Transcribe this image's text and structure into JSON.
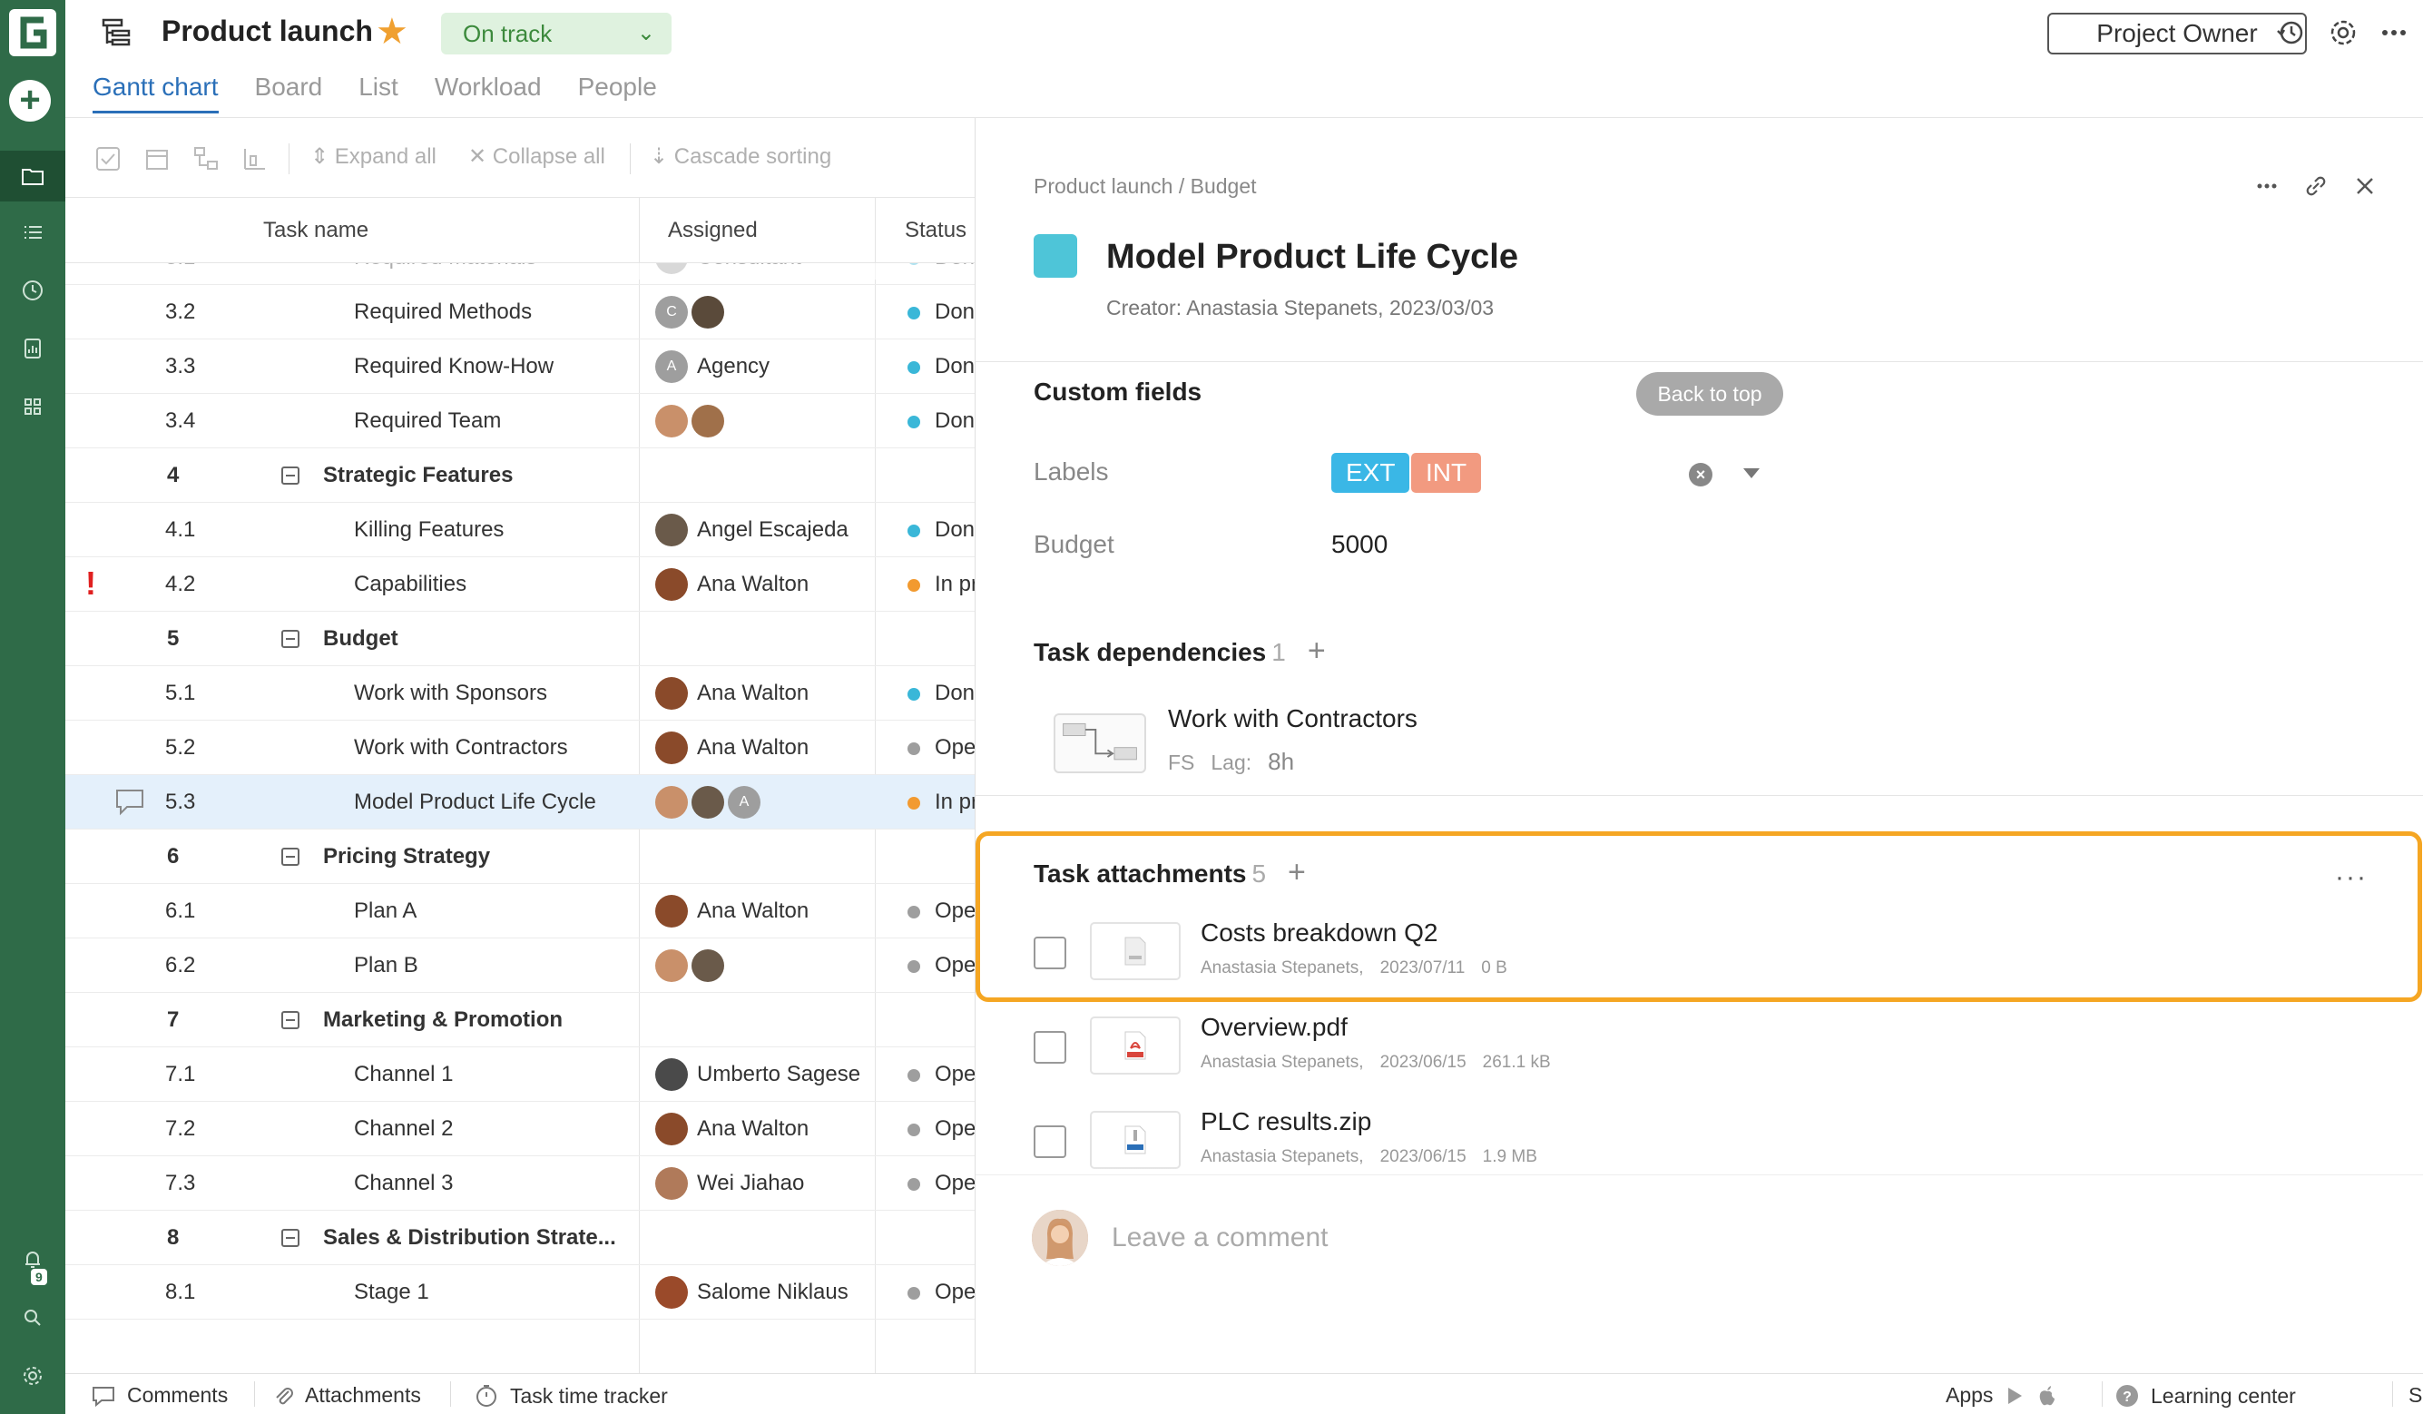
{
  "app": {
    "project_title": "Product launch",
    "status": "On track",
    "project_owner": "Project Owner",
    "notification_count": "9"
  },
  "tabs": [
    {
      "label": "Gantt chart",
      "active": true
    },
    {
      "label": "Board"
    },
    {
      "label": "List"
    },
    {
      "label": "Workload"
    },
    {
      "label": "People"
    }
  ],
  "toolbar": {
    "expand_all": "Expand all",
    "collapse_all": "Collapse all",
    "cascade_sorting": "Cascade sorting"
  },
  "table": {
    "headers": {
      "task_name": "Task name",
      "assigned": "Assigned",
      "status": "Status"
    },
    "rows": [
      {
        "num": "3.1",
        "name": "Required Materials",
        "assignee": "Consultant",
        "status": "Done",
        "status_color": "#3ab7d8",
        "avatars": [
          "C"
        ]
      },
      {
        "num": "3.2",
        "name": "Required Methods",
        "assignee": "",
        "status": "Done",
        "status_color": "#3ab7d8",
        "avatars": [
          "C",
          "p1"
        ]
      },
      {
        "num": "3.3",
        "name": "Required Know-How",
        "assignee": "Agency",
        "status": "Done",
        "status_color": "#3ab7d8",
        "avatars": [
          "A"
        ]
      },
      {
        "num": "3.4",
        "name": "Required Team",
        "assignee": "",
        "status": "Done",
        "status_color": "#3ab7d8",
        "avatars": [
          "p2",
          "p3"
        ]
      },
      {
        "num": "4",
        "name": "Strategic Features",
        "group": true
      },
      {
        "num": "4.1",
        "name": "Killing Features",
        "assignee": "Angel Escajeda",
        "status": "Done",
        "status_color": "#3ab7d8",
        "avatars": [
          "p4"
        ]
      },
      {
        "num": "4.2",
        "name": "Capabilities",
        "assignee": "Ana Walton",
        "status": "In progress",
        "status_color": "#f29a30",
        "avatars": [
          "p5"
        ],
        "warning": true
      },
      {
        "num": "5",
        "name": "Budget",
        "group": true
      },
      {
        "num": "5.1",
        "name": "Work with Sponsors",
        "assignee": "Ana Walton",
        "status": "Done",
        "status_color": "#3ab7d8",
        "avatars": [
          "p5"
        ]
      },
      {
        "num": "5.2",
        "name": "Work with Contractors",
        "assignee": "Ana Walton",
        "status": "Open",
        "status_color": "#9e9e9e",
        "avatars": [
          "p5"
        ]
      },
      {
        "num": "5.3",
        "name": "Model Product Life Cycle",
        "assignee": "",
        "status": "In progress",
        "status_color": "#f29a30",
        "avatars": [
          "p2",
          "p4",
          "A"
        ],
        "selected": true,
        "comment": true
      },
      {
        "num": "6",
        "name": "Pricing Strategy",
        "group": true
      },
      {
        "num": "6.1",
        "name": "Plan A",
        "assignee": "Ana Walton",
        "status": "Open",
        "status_color": "#9e9e9e",
        "avatars": [
          "p5"
        ]
      },
      {
        "num": "6.2",
        "name": "Plan B",
        "assignee": "",
        "status": "Open",
        "status_color": "#9e9e9e",
        "avatars": [
          "p2",
          "p4"
        ]
      },
      {
        "num": "7",
        "name": "Marketing & Promotion",
        "group": true
      },
      {
        "num": "7.1",
        "name": "Channel 1",
        "assignee": "Umberto Sagese",
        "status": "Open",
        "status_color": "#9e9e9e",
        "avatars": [
          "p6"
        ]
      },
      {
        "num": "7.2",
        "name": "Channel 2",
        "assignee": "Ana Walton",
        "status": "Open",
        "status_color": "#9e9e9e",
        "avatars": [
          "p5"
        ]
      },
      {
        "num": "7.3",
        "name": "Channel 3",
        "assignee": "Wei Jiahao",
        "status": "Open",
        "status_color": "#9e9e9e",
        "avatars": [
          "p7"
        ]
      },
      {
        "num": "8",
        "name": "Sales & Distribution Strate...",
        "group": true
      },
      {
        "num": "8.1",
        "name": "Stage 1",
        "assignee": "Salome Niklaus",
        "status": "Open",
        "status_color": "#9e9e9e",
        "avatars": [
          "p8"
        ]
      }
    ]
  },
  "bottombar": {
    "comments": "Comments",
    "attachments": "Attachments",
    "time_tracker": "Task time tracker",
    "apps": "Apps",
    "learning_center": "Learning center",
    "support": "Support"
  },
  "panel": {
    "breadcrumb": "Product launch / Budget",
    "title": "Model Product Life Cycle",
    "color": "#4ec5d8",
    "creator": "Creator: Anastasia Stepanets, 2023/03/03",
    "custom_fields_title": "Custom fields",
    "back_to_top": "Back to top",
    "labels_label": "Labels",
    "labels": [
      {
        "text": "EXT",
        "color": "#3ab7e6"
      },
      {
        "text": "INT",
        "color": "#f29a80"
      }
    ],
    "budget_label": "Budget",
    "budget_value": "5000",
    "dependencies_title": "Task dependencies",
    "dependencies_count": "1",
    "dependency": {
      "name": "Work with Contractors",
      "type": "FS",
      "lag_label": "Lag:",
      "lag_value": "8h"
    },
    "attachments_title": "Task attachments",
    "attachments_count": "5",
    "attachments": [
      {
        "name": "Costs breakdown Q2",
        "author": "Anastasia Stepanets,",
        "date": "2023/07/11",
        "size": "0 B",
        "type": "doc"
      },
      {
        "name": "Overview.pdf",
        "author": "Anastasia Stepanets,",
        "date": "2023/06/15",
        "size": "261.1 kB",
        "type": "pdf"
      },
      {
        "name": "PLC results.zip",
        "author": "Anastasia Stepanets,",
        "date": "2023/06/15",
        "size": "1.9 MB",
        "type": "zip"
      }
    ],
    "comment_placeholder": "Leave a comment"
  }
}
